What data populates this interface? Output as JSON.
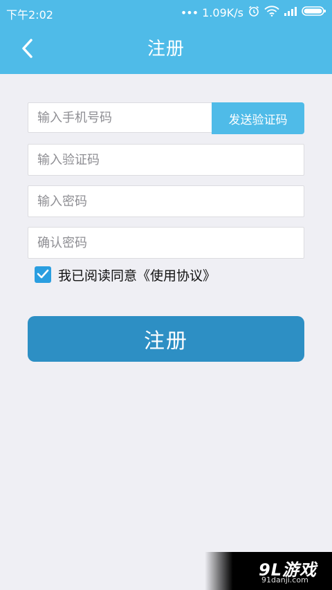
{
  "status_bar": {
    "time": "下午2:02",
    "speed": "1.09K/s"
  },
  "navbar": {
    "title": "注册",
    "back_icon": "chevron-left-icon"
  },
  "form": {
    "phone_placeholder": "输入手机号码",
    "send_code_label": "发送验证码",
    "code_placeholder": "输入验证码",
    "password_placeholder": "输入密码",
    "confirm_placeholder": "确认密码",
    "agree_checked": true,
    "agree_text": "我已阅读同意《使用协议》",
    "register_label": "注册"
  },
  "watermark": {
    "logo": "9L游戏",
    "url": "91danji.com"
  },
  "colors": {
    "header": "#4fbbe8",
    "primary_button": "#2d8fc4",
    "checkbox": "#2a9ee0",
    "background": "#efeff4"
  }
}
